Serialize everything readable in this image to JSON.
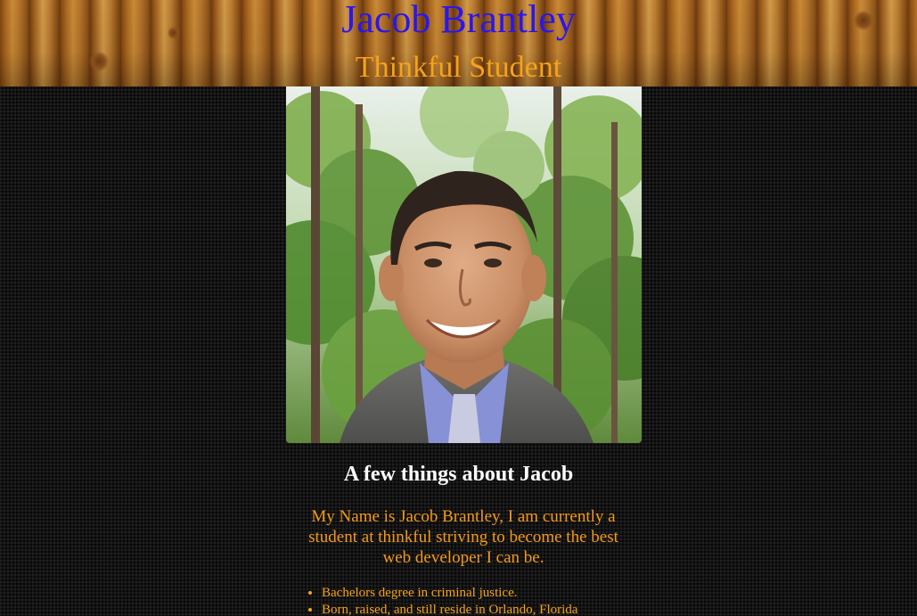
{
  "header": {
    "name": "Jacob Brantley",
    "role": "Thinkful Student"
  },
  "profile_photo": {
    "alt": "Jacob Brantley"
  },
  "about": {
    "heading": "A few things about Jacob",
    "bio": "My Name is Jacob Brantley, I am currently a student at thinkful striving to become the best web developer I can be.",
    "facts": [
      "Bachelors degree in criminal justice.",
      "Born, raised, and still reside in Orlando, Florida"
    ]
  },
  "colors": {
    "title": "#2a16ee",
    "subtitle": "#f5a31a",
    "heading": "#ffffff",
    "body_text": "#f59a1a",
    "background": "#141414"
  }
}
